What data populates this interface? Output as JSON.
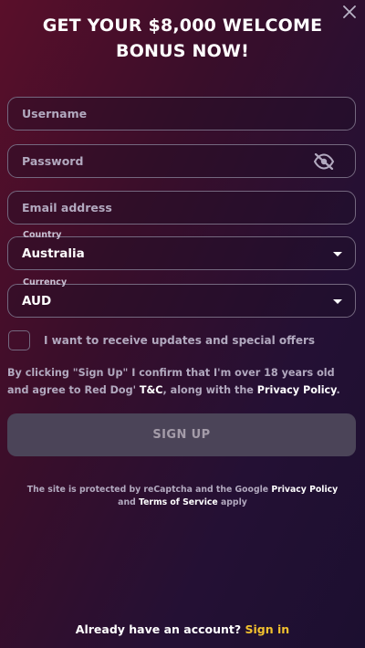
{
  "modal": {
    "close_icon": "close-icon",
    "title_line1": "GET YOUR $8,000 WELCOME",
    "title_line2": "BONUS NOW!"
  },
  "form": {
    "username_placeholder": "Username",
    "password_placeholder": "Password",
    "password_toggle_icon": "eye-off-icon",
    "email_placeholder": "Email address",
    "country_label": "Country",
    "country_value": "Australia",
    "currency_label": "Currency",
    "currency_value": "AUD",
    "updates_checkbox_label": "I want to receive updates and special offers",
    "updates_checked": false
  },
  "terms": {
    "text_before": "By clicking \"Sign Up\" I confirm that I'm over 18 years old and agree to Red Dog' ",
    "tc_link": "T&C",
    "text_middle": ", along with the ",
    "privacy_link": "Privacy Policy",
    "text_end": "."
  },
  "signup_button": "SIGN UP",
  "recaptcha": {
    "text_before": "The site is protected by reCaptcha and the Google ",
    "privacy_link": "Privacy Policy",
    "text_middle": "and ",
    "terms_link": "Terms of Service",
    "text_end": " apply"
  },
  "footer": {
    "question": "Already have an account?",
    "signin_link": "Sign in"
  },
  "colors": {
    "accent_signin": "#f2c12e",
    "button_bg": "#4b4458",
    "border": "#74687f"
  }
}
